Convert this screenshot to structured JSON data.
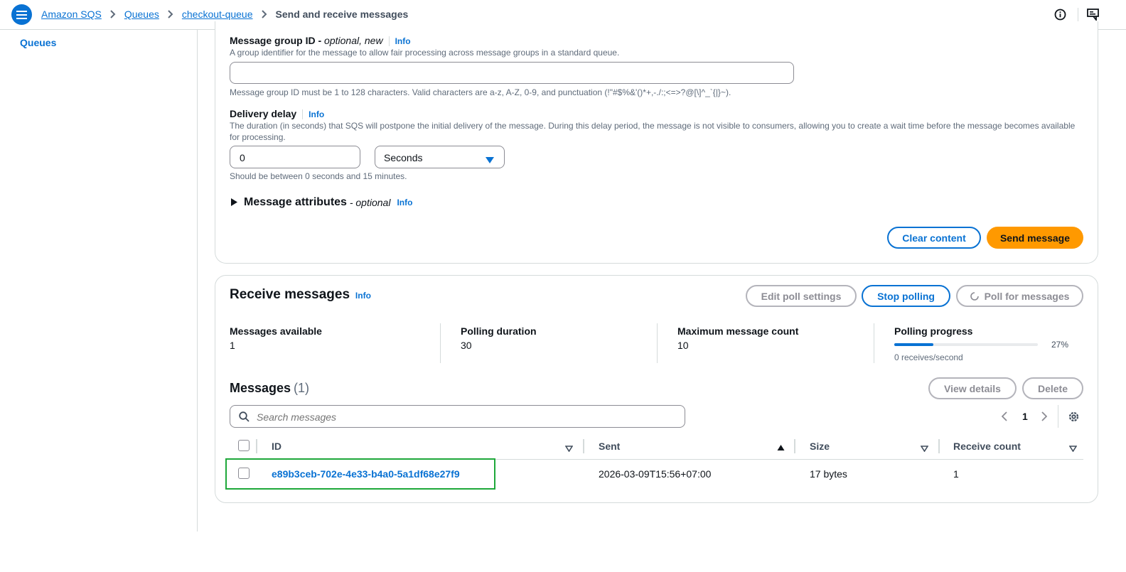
{
  "breadcrumb": {
    "items": [
      "Amazon SQS",
      "Queues",
      "checkout-queue"
    ],
    "current": "Send and receive messages"
  },
  "sidebar": {
    "items": [
      {
        "label": "Queues"
      }
    ]
  },
  "send": {
    "group_id": {
      "label": "Message group ID",
      "qualifier": "optional, new",
      "info": "Info",
      "description": "A group identifier for the message to allow fair processing across message groups in a standard queue.",
      "value": "",
      "constraint": "Message group ID must be 1 to 128 characters. Valid characters are a-z, A-Z, 0-9, and punctuation (!\"#$%&'()*+,-./:;<=>?@[\\]^_`{|}~)."
    },
    "delay": {
      "label": "Delivery delay",
      "info": "Info",
      "description": "The duration (in seconds) that SQS will postpone the initial delivery of the message. During this delay period, the message is not visible to consumers, allowing you to create a wait time before the message becomes available for processing.",
      "value": "0",
      "unit": "Seconds",
      "constraint": "Should be between 0 seconds and 15 minutes."
    },
    "attributes": {
      "label": "Message attributes",
      "qualifier": "optional",
      "info": "Info"
    },
    "buttons": {
      "clear": "Clear content",
      "send": "Send message"
    }
  },
  "receive": {
    "title": "Receive messages",
    "info": "Info",
    "buttons": {
      "edit": "Edit poll settings",
      "stop": "Stop polling",
      "poll": "Poll for messages"
    },
    "stats": [
      {
        "label": "Messages available",
        "value": "1"
      },
      {
        "label": "Polling duration",
        "value": "30"
      },
      {
        "label": "Maximum message count",
        "value": "10"
      }
    ],
    "progress": {
      "label": "Polling progress",
      "percent": 27,
      "percent_text": "27%",
      "rate": "0 receives/second"
    }
  },
  "messages": {
    "title": "Messages",
    "count": "(1)",
    "buttons": {
      "view": "View details",
      "delete": "Delete"
    },
    "search_placeholder": "Search messages",
    "page": "1",
    "columns": [
      "ID",
      "Sent",
      "Size",
      "Receive count"
    ],
    "rows": [
      {
        "id": "e89b3ceb-702e-4e33-b4a0-5a1df68e27f9",
        "sent": "2026-03-09T15:56+07:00",
        "size": "17 bytes",
        "receive_count": "1"
      }
    ]
  },
  "colors": {
    "accent": "#0972d3",
    "primary_button": "#ff9900",
    "highlight": "#1ea83a"
  }
}
